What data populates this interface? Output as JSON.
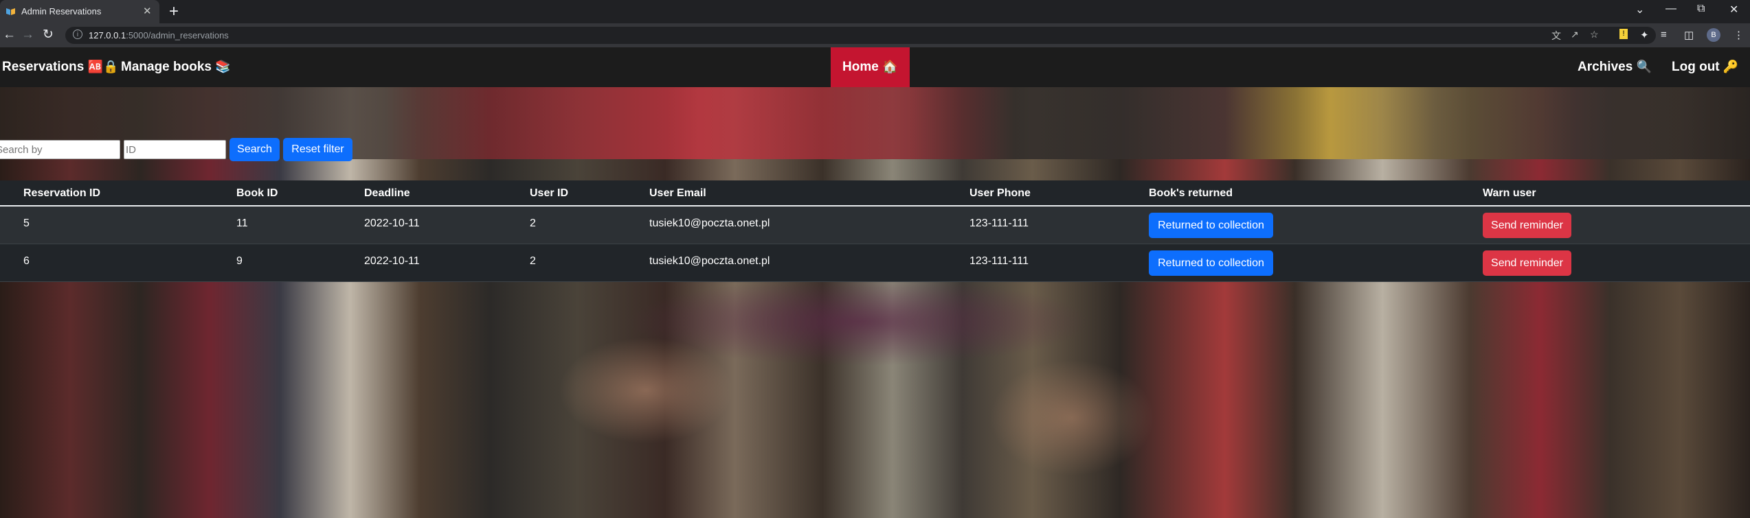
{
  "browser": {
    "tab_title": "Admin Reservations",
    "tab_close": "✕",
    "new_tab": "+",
    "url_host": "127.0.0.1",
    "url_path": ":5000/admin_reservations",
    "profile_initial": "B",
    "window_controls": [
      "⌄",
      "—",
      "⧉",
      "✕"
    ]
  },
  "nav": {
    "reservations": "Reservations",
    "reservations_icon": "🆎🔒",
    "manage_books": "Manage books",
    "manage_books_icon": "📚",
    "home": "Home",
    "home_icon": "🏠",
    "archives": "Archives",
    "archives_icon": "🔍",
    "logout": "Log out",
    "logout_icon": "🔑"
  },
  "search": {
    "search_by_placeholder": "Search by",
    "id_placeholder": "ID",
    "search_button": "Search",
    "reset_button": "Reset filter"
  },
  "table": {
    "columns": [
      "Reservation ID",
      "Book ID",
      "Deadline",
      "User ID",
      "User Email",
      "User Phone",
      "Book's returned",
      "Warn user"
    ],
    "rows": [
      {
        "reservation_id": "5",
        "book_id": "11",
        "deadline": "2022-10-11",
        "user_id": "2",
        "email": "tusiek10@poczta.onet.pl",
        "phone": "123-111-111",
        "returned_button": "Returned to collection",
        "warn_button": "Send reminder"
      },
      {
        "reservation_id": "6",
        "book_id": "9",
        "deadline": "2022-10-11",
        "user_id": "2",
        "email": "tusiek10@poczta.onet.pl",
        "phone": "123-111-111",
        "returned_button": "Returned to collection",
        "warn_button": "Send reminder"
      }
    ]
  },
  "colors": {
    "primary_button": "#0d6efd",
    "danger_button": "#dc3545",
    "home_active": "#c41530",
    "navbar": "#1c1c1c",
    "table_dark": "#212529"
  }
}
